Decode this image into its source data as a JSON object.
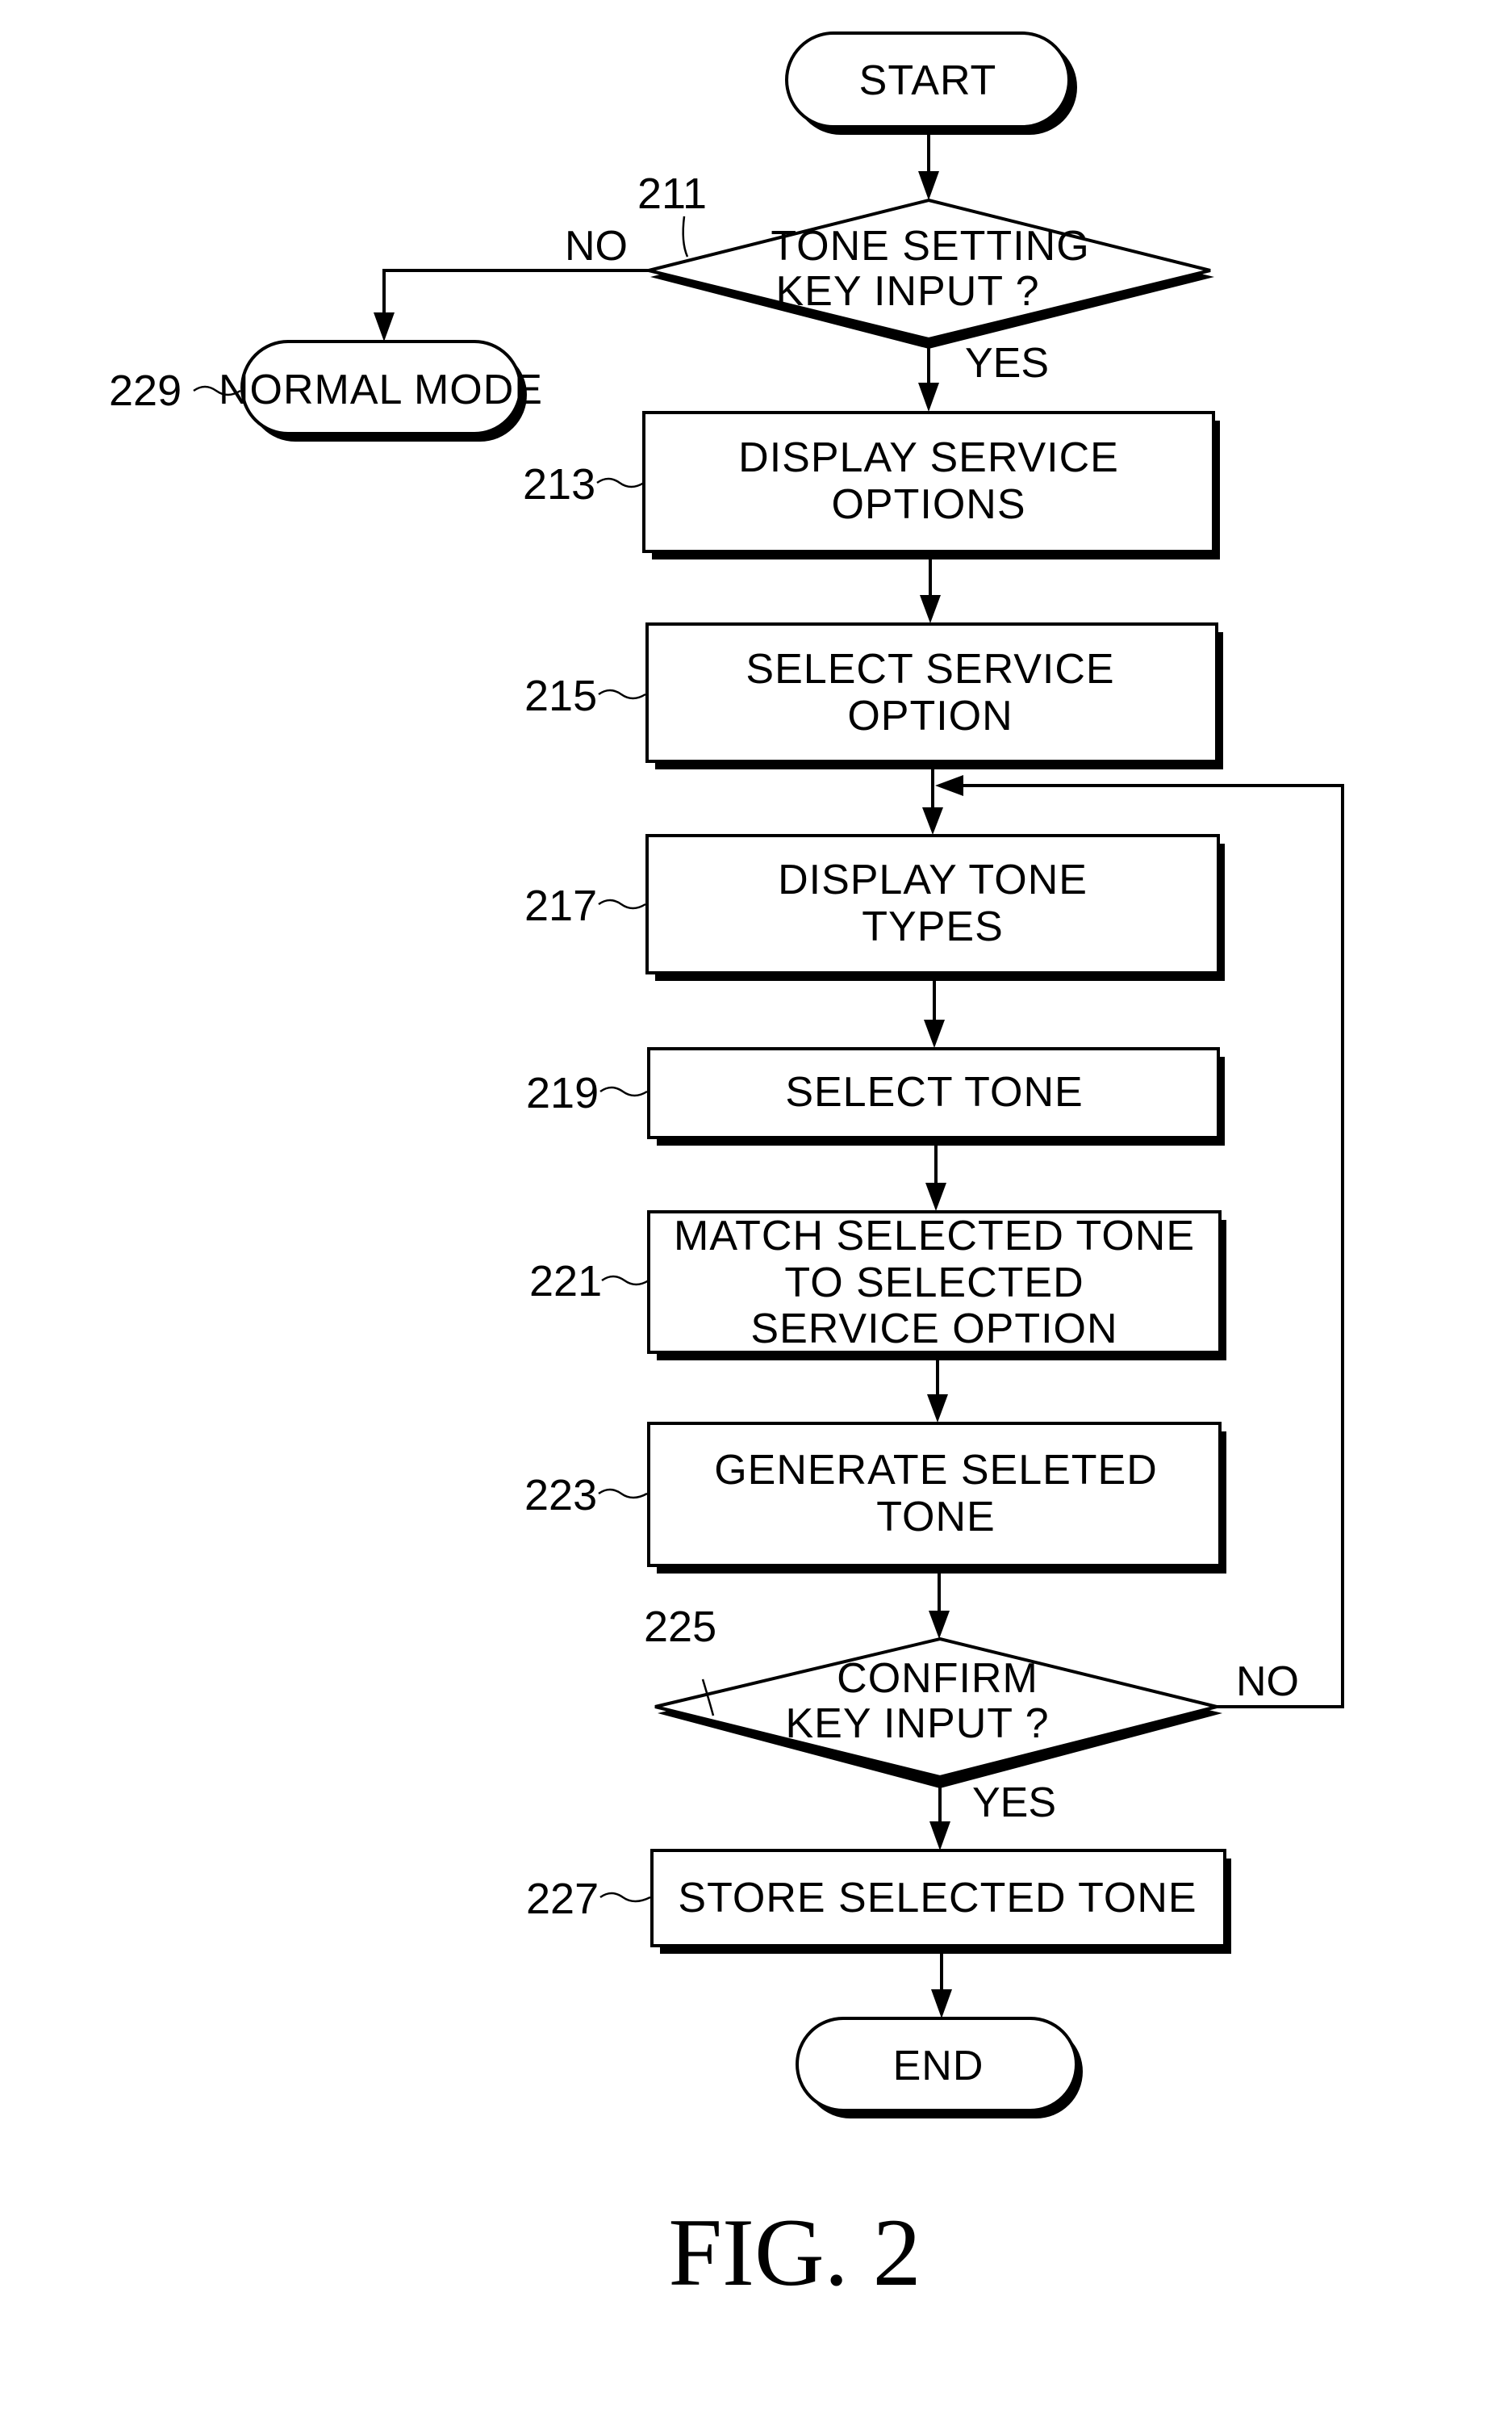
{
  "figure_caption": "FIG. 2",
  "nodes": {
    "start": {
      "text": "START"
    },
    "n211": {
      "ref": "211",
      "lines": [
        "TONE SETTING",
        "KEY INPUT ?"
      ],
      "yes": "YES",
      "no": "NO"
    },
    "n229": {
      "ref": "229",
      "text": "NORMAL MODE"
    },
    "n213": {
      "ref": "213",
      "lines": [
        "DISPLAY SERVICE",
        "OPTIONS"
      ]
    },
    "n215": {
      "ref": "215",
      "lines": [
        "SELECT SERVICE",
        "OPTION"
      ]
    },
    "n217": {
      "ref": "217",
      "lines": [
        "DISPLAY TONE",
        "TYPES"
      ]
    },
    "n219": {
      "ref": "219",
      "lines": [
        "SELECT TONE"
      ]
    },
    "n221": {
      "ref": "221",
      "lines": [
        "MATCH SELECTED TONE",
        "TO SELECTED",
        "SERVICE OPTION"
      ]
    },
    "n223": {
      "ref": "223",
      "lines": [
        "GENERATE SELETED",
        "TONE"
      ]
    },
    "n225": {
      "ref": "225",
      "lines": [
        "CONFIRM",
        "KEY INPUT ?"
      ],
      "yes": "YES",
      "no": "NO"
    },
    "n227": {
      "ref": "227",
      "lines": [
        "STORE SELECTED TONE"
      ]
    },
    "end": {
      "text": "END"
    }
  },
  "edges": [
    {
      "from": "start",
      "to": "n211"
    },
    {
      "from": "n211",
      "to": "n213",
      "label": "YES"
    },
    {
      "from": "n211",
      "to": "n229",
      "label": "NO"
    },
    {
      "from": "n213",
      "to": "n215"
    },
    {
      "from": "n215",
      "to": "n217"
    },
    {
      "from": "n217",
      "to": "n219"
    },
    {
      "from": "n219",
      "to": "n221"
    },
    {
      "from": "n221",
      "to": "n223"
    },
    {
      "from": "n223",
      "to": "n225"
    },
    {
      "from": "n225",
      "to": "n227",
      "label": "YES"
    },
    {
      "from": "n225",
      "to": "n217",
      "label": "NO"
    },
    {
      "from": "n227",
      "to": "end"
    }
  ]
}
